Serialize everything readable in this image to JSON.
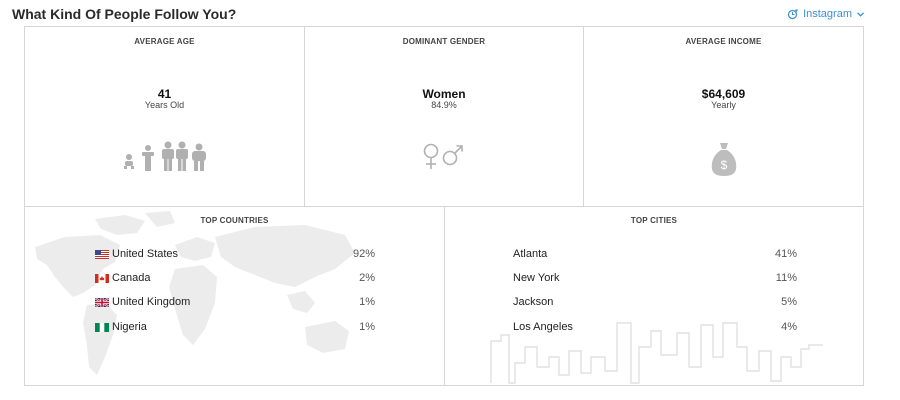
{
  "header": {
    "title": "What Kind Of People Follow You?",
    "network": "Instagram"
  },
  "stats": [
    {
      "title": "AVERAGE AGE",
      "value": "41",
      "sub": "Years Old",
      "icon": "people-age-icon"
    },
    {
      "title": "DOMINANT GENDER",
      "value": "Women",
      "sub": "84.9%",
      "icon": "gender-symbols-icon"
    },
    {
      "title": "AVERAGE INCOME",
      "value": "$64,609",
      "sub": "Yearly",
      "icon": "money-bag-icon"
    }
  ],
  "countries": {
    "title": "TOP COUNTRIES",
    "items": [
      {
        "name": "United States",
        "pct": "92%",
        "flag": "us-flag-icon"
      },
      {
        "name": "Canada",
        "pct": "2%",
        "flag": "canada-flag-icon"
      },
      {
        "name": "United Kingdom",
        "pct": "1%",
        "flag": "uk-flag-icon"
      },
      {
        "name": "Nigeria",
        "pct": "1%",
        "flag": "nigeria-flag-icon"
      }
    ]
  },
  "cities": {
    "title": "TOP CITIES",
    "items": [
      {
        "name": "Atlanta",
        "pct": "41%"
      },
      {
        "name": "New York",
        "pct": "11%"
      },
      {
        "name": "Jackson",
        "pct": "5%"
      },
      {
        "name": "Los Angeles",
        "pct": "4%"
      }
    ]
  },
  "colors": {
    "accent": "#3b8fd6",
    "border": "#d6d6d6",
    "icon_gray": "#a8a8a8"
  }
}
